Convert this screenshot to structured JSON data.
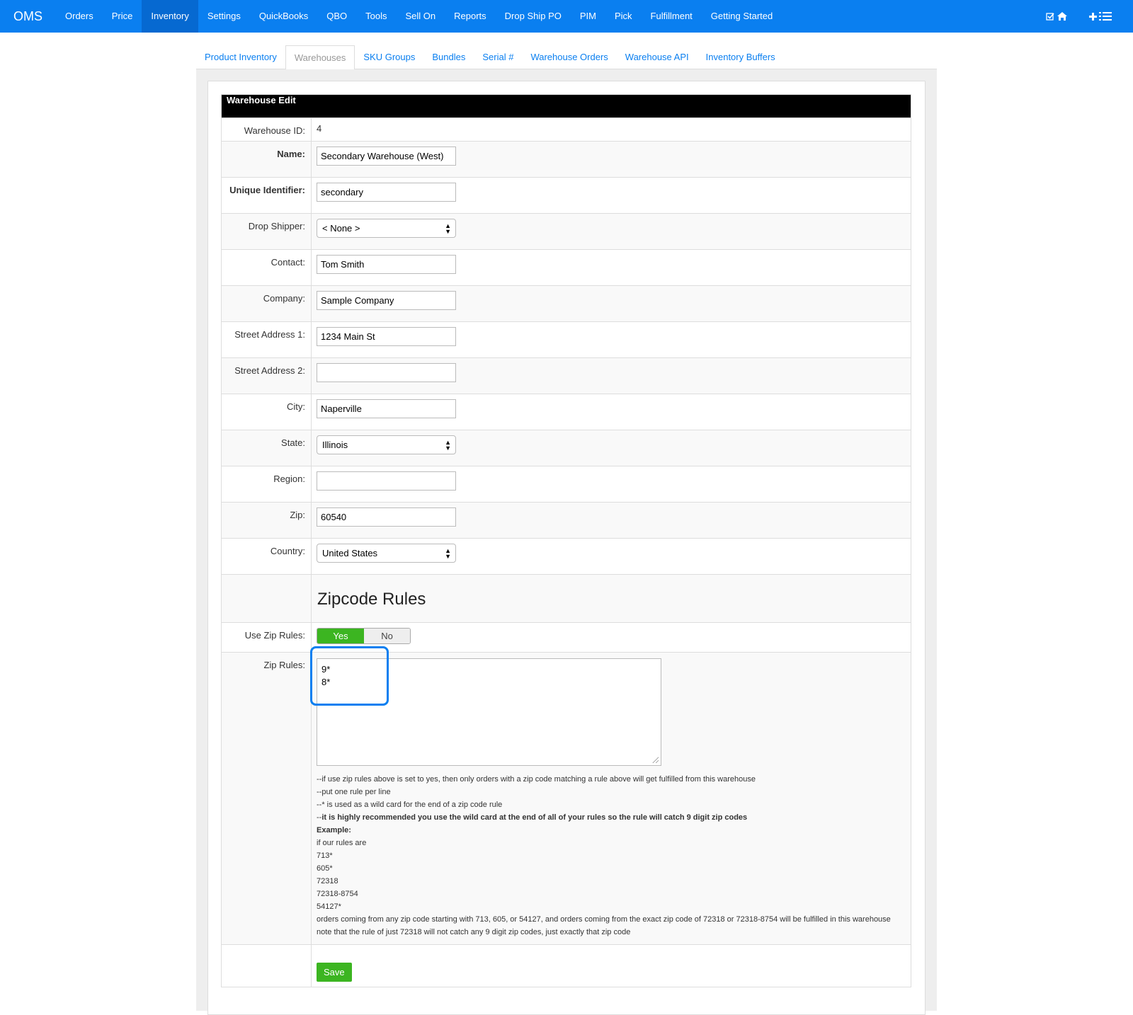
{
  "nav": {
    "brand": "OMS",
    "items": [
      "Orders",
      "Price",
      "Inventory",
      "Settings",
      "QuickBooks",
      "QBO",
      "Tools",
      "Sell On",
      "Reports",
      "Drop Ship PO",
      "PIM",
      "Pick",
      "Fulfillment",
      "Getting Started"
    ],
    "active": "Inventory",
    "right_icons": [
      "check-icon",
      "home-icon",
      "plus-icon",
      "list-icon"
    ]
  },
  "subtabs": {
    "items": [
      "Product Inventory",
      "Warehouses",
      "SKU Groups",
      "Bundles",
      "Serial #",
      "Warehouse Orders",
      "Warehouse API",
      "Inventory Buffers"
    ],
    "active": "Warehouses"
  },
  "form": {
    "title": "Warehouse Edit",
    "warehouse_id_label": "Warehouse ID:",
    "warehouse_id": "4",
    "name_label": "Name:",
    "name": "Secondary Warehouse (West)",
    "uid_label": "Unique Identifier:",
    "uid": "secondary",
    "drop_shipper_label": "Drop Shipper:",
    "drop_shipper": "< None >",
    "contact_label": "Contact:",
    "contact": "Tom Smith",
    "company_label": "Company:",
    "company": "Sample Company",
    "street1_label": "Street Address 1:",
    "street1": "1234 Main St",
    "street2_label": "Street Address 2:",
    "street2": "",
    "city_label": "City:",
    "city": "Naperville",
    "state_label": "State:",
    "state": "Illinois",
    "region_label": "Region:",
    "region": "",
    "zip_label": "Zip:",
    "zip": "60540",
    "country_label": "Country:",
    "country": "United States",
    "zip_section_title": "Zipcode Rules",
    "use_zip_label": "Use Zip Rules:",
    "use_zip_yes": "Yes",
    "use_zip_no": "No",
    "use_zip_value": "Yes",
    "zip_rules_label": "Zip Rules:",
    "zip_rules": "9*\n8*",
    "help": {
      "line1": "--if use zip rules above is set to yes, then only orders with a zip code matching a rule above will get fulfilled from this warehouse",
      "line2": "--put one rule per line",
      "line3": "--* is used as a wild card for the end of a zip code rule",
      "line4_prefix": "--",
      "line4_bold": "it is highly recommended you use the wild card at the end of all of your rules so the rule will catch 9 digit zip codes",
      "example_label": "Example:",
      "example_intro": "if our rules are",
      "examples": [
        "713*",
        "605*",
        "72318",
        "72318-8754",
        "54127*"
      ],
      "explain1": "orders coming from any zip code starting with 713, 605, or 54127, and orders coming from the exact zip code of 72318 or 72318-8754 will be fulfilled in this warehouse",
      "explain2": "note that the rule of just 72318 will not catch any 9 digit zip codes, just exactly that zip code"
    },
    "save_label": "Save"
  },
  "colors": {
    "nav_bg": "#0a7ff0",
    "nav_active": "#0669d1",
    "link": "#0a7ff0",
    "toggle_on": "#3cb521",
    "save_bg": "#3cb521",
    "highlight": "#0a7ff0"
  }
}
